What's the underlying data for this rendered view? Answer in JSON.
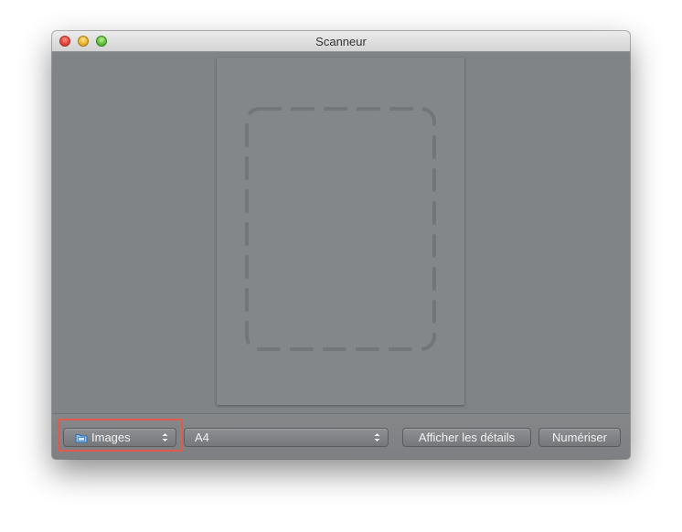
{
  "window": {
    "title": "Scanneur"
  },
  "toolbar": {
    "destination_popup": {
      "selected": "Images",
      "icon": "folder-icon"
    },
    "size_popup": {
      "selected": "A4"
    },
    "show_details_label": "Afficher les détails",
    "scan_label": "Numériser"
  },
  "colors": {
    "window_background": "#818487",
    "highlight_border": "#e25a4d"
  }
}
